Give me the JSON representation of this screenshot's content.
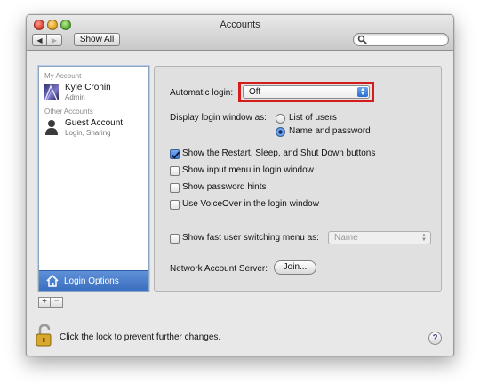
{
  "window": {
    "title": "Accounts"
  },
  "toolbar": {
    "back_icon": "◀",
    "forward_icon": "▶",
    "show_all_label": "Show All",
    "search_value": ""
  },
  "sidebar": {
    "my_account_header": "My Account",
    "my_account": {
      "name": "Kyle Cronin",
      "role": "Admin"
    },
    "other_accounts_header": "Other Accounts",
    "other_accounts": [
      {
        "name": "Guest Account",
        "role": "Login, Sharing"
      }
    ],
    "login_options_label": "Login Options",
    "add_label": "+",
    "remove_label": "−"
  },
  "login_options": {
    "automatic_login_label": "Automatic login:",
    "automatic_login_value": "Off",
    "display_login_window_label": "Display login window as:",
    "display_options": [
      {
        "label": "List of users",
        "selected": false
      },
      {
        "label": "Name and password",
        "selected": true
      }
    ],
    "checkboxes": [
      {
        "label": "Show the Restart, Sleep, and Shut Down buttons",
        "checked": true
      },
      {
        "label": "Show input menu in login window",
        "checked": false
      },
      {
        "label": "Show password hints",
        "checked": false
      },
      {
        "label": "Use VoiceOver in the login window",
        "checked": false
      }
    ],
    "fast_user_switching": {
      "label": "Show fast user switching menu as:",
      "checked": false,
      "value": "Name"
    },
    "network_account_server_label": "Network Account Server:",
    "join_label": "Join..."
  },
  "footer": {
    "lock_text": "Click the lock to prevent further changes.",
    "help_label": "?"
  },
  "colors": {
    "highlight": "#d41c1c",
    "selection": "#4a7fcc",
    "accent": "#3f7fd8"
  }
}
